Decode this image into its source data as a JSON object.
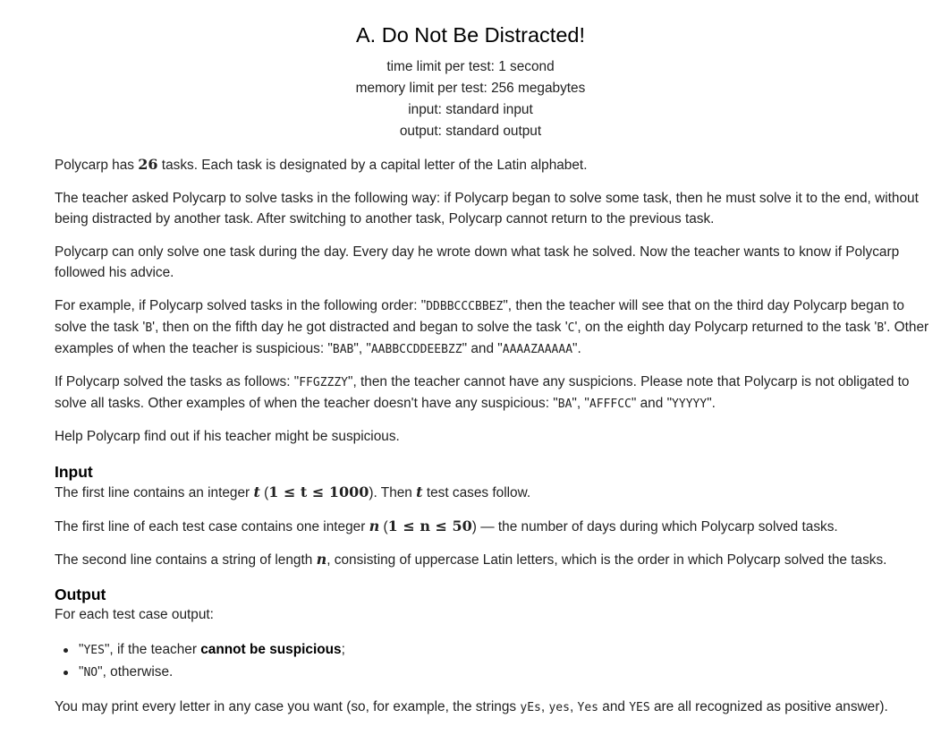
{
  "problem": {
    "title": "A. Do Not Be Distracted!",
    "time_limit": {
      "label": "time limit per test",
      "value": "1 second"
    },
    "memory_limit": {
      "label": "memory limit per test",
      "value": "256 megabytes"
    },
    "input": {
      "label": "input",
      "value": "standard input"
    },
    "output": {
      "label": "output",
      "value": "standard output"
    }
  },
  "statement": {
    "p1": {
      "a": "Polycarp has ",
      "num": "26",
      "b": " tasks. Each task is designated by a capital letter of the Latin alphabet."
    },
    "p2": "The teacher asked Polycarp to solve tasks in the following way: if Polycarp began to solve some task, then he must solve it to the end, without being distracted by another task. After switching to another task, Polycarp cannot return to the previous task.",
    "p3": "Polycarp can only solve one task during the day. Every day he wrote down what task he solved. Now the teacher wants to know if Polycarp followed his advice.",
    "p4": {
      "a": "For example, if Polycarp solved tasks in the following order: \"",
      "s1": "DDBBCCCBBEZ",
      "b": "\", then the teacher will see that on the third day Polycarp began to solve the task '",
      "s2": "B",
      "c": "', then on the fifth day he got distracted and began to solve the task '",
      "s3": "C",
      "d": "', on the eighth day Polycarp returned to the task '",
      "s4": "B",
      "e": "'. Other examples of when the teacher is suspicious: \"",
      "s5": "BAB",
      "f": "\", \"",
      "s6": "AABBCCDDEEBZZ",
      "g": "\" and \"",
      "s7": "AAAAZAAAAA",
      "h": "\"."
    },
    "p5": {
      "a": "If Polycarp solved the tasks as follows: \"",
      "s1": "FFGZZZY",
      "b": "\", then the teacher cannot have any suspicions. Please note that Polycarp is not obligated to solve all tasks. Other examples of when the teacher doesn't have any suspicious: \"",
      "s2": "BA",
      "c": "\", \"",
      "s3": "AFFFCC",
      "d": "\" and \"",
      "s4": "YYYYY",
      "e": "\"."
    },
    "p6": "Help Polycarp find out if his teacher might be suspicious."
  },
  "input_section": {
    "title": "Input",
    "l1": {
      "a": "The first line contains an integer ",
      "v": "t",
      "b": " (",
      "math": "1 ≤ t ≤ 1000",
      "c": "). Then ",
      "v2": "t",
      "d": " test cases follow."
    },
    "l2": {
      "a": "The first line of each test case contains one integer ",
      "v": "n",
      "b": " (",
      "math": "1 ≤ n ≤ 50",
      "c": ") — the number of days during which Polycarp solved tasks."
    },
    "l3": {
      "a": "The second line contains a string of length ",
      "v": "n",
      "b": ", consisting of uppercase Latin letters, which is the order in which Polycarp solved the tasks."
    }
  },
  "output_section": {
    "title": "Output",
    "intro": "For each test case output:",
    "bullet1": {
      "q1": "\"",
      "code": "YES",
      "q2": "\", if the teacher ",
      "bold": "cannot be suspicious",
      "end": ";"
    },
    "bullet2": {
      "q1": "\"",
      "code": "NO",
      "q2": "\", otherwise."
    },
    "note": {
      "a": "You may print every letter in any case you want (so, for example, the strings ",
      "c1": "yEs",
      "s1": ", ",
      "c2": "yes",
      "s2": ", ",
      "c3": "Yes",
      "s3": " and ",
      "c4": "YES",
      "b": " are all recognized as positive answer)."
    }
  }
}
